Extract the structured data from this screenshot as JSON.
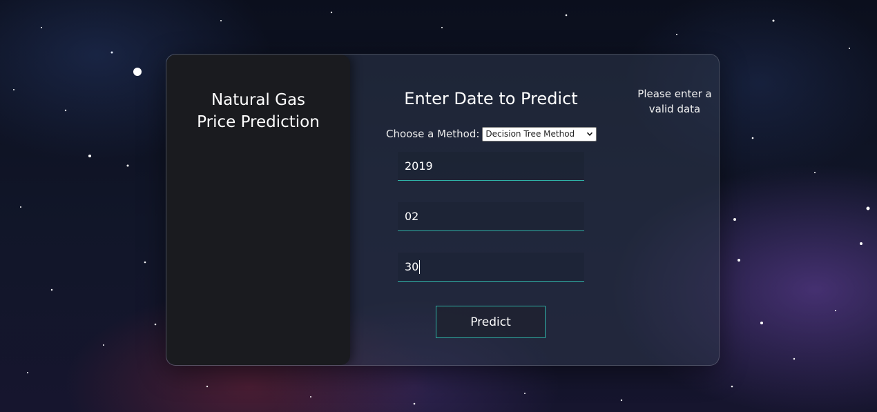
{
  "sidebar": {
    "title": "Natural Gas\nPrice Prediction"
  },
  "form": {
    "title": "Enter Date to Predict",
    "method_label": "Choose a Method:",
    "method_selected": "Decision Tree Method",
    "year_value": "2019",
    "month_value": "02",
    "day_value": "30",
    "predict_label": "Predict"
  },
  "status": {
    "message": "Please enter a\nvalid data"
  },
  "icons": {
    "select_arrow": "chevron-down-icon"
  },
  "colors": {
    "accent": "#2fb3a8",
    "panel_dark": "#1a1b1f"
  }
}
